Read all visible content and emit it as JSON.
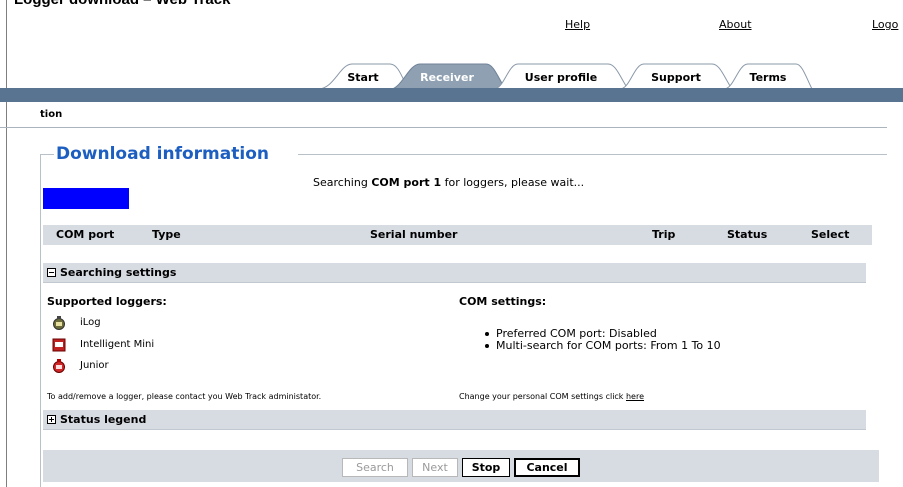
{
  "window": {
    "title": "Logger download – Web Track"
  },
  "toplinks": {
    "help": "Help",
    "about": "About",
    "logout": "Logo"
  },
  "tabs": [
    {
      "label": "Start"
    },
    {
      "label": "Receiver"
    },
    {
      "label": "User profile"
    },
    {
      "label": "Support"
    },
    {
      "label": "Terms"
    }
  ],
  "breadcrumb": "tion",
  "main": {
    "title": "Download information",
    "search_status_prefix": "Searching ",
    "search_status_port": "COM port 1",
    "search_status_suffix": " for loggers, please wait...",
    "progress_fraction": 1.0,
    "table_headers": {
      "com_port": "COM port",
      "type": "Type",
      "serial": "Serial number",
      "trip": "Trip",
      "status": "Status",
      "select": "Select"
    }
  },
  "searching_settings": {
    "header": "Searching settings",
    "supported_loggers_title": "Supported loggers:",
    "loggers": [
      {
        "name": "iLog",
        "icon": "ilog-icon"
      },
      {
        "name": "Intelligent Mini",
        "icon": "intelligent-mini-icon"
      },
      {
        "name": "Junior",
        "icon": "junior-icon"
      }
    ],
    "contact_note": "To add/remove a logger, please contact you Web Track administator.",
    "com_settings_title": "COM settings:",
    "com_settings": [
      "Preferred COM port: Disabled",
      "Multi-search for COM ports: From 1 To 10"
    ],
    "change_note": "Change your personal COM settings click ",
    "change_link": "here"
  },
  "status_legend": {
    "header": "Status legend"
  },
  "buttons": {
    "search": "Search",
    "next": "Next",
    "stop": "Stop",
    "cancel": "Cancel"
  },
  "colors": {
    "accent": "#1d5fc1",
    "nav_bar": "#587490",
    "progress": "#0000ff",
    "panel": "#d7dce3"
  }
}
